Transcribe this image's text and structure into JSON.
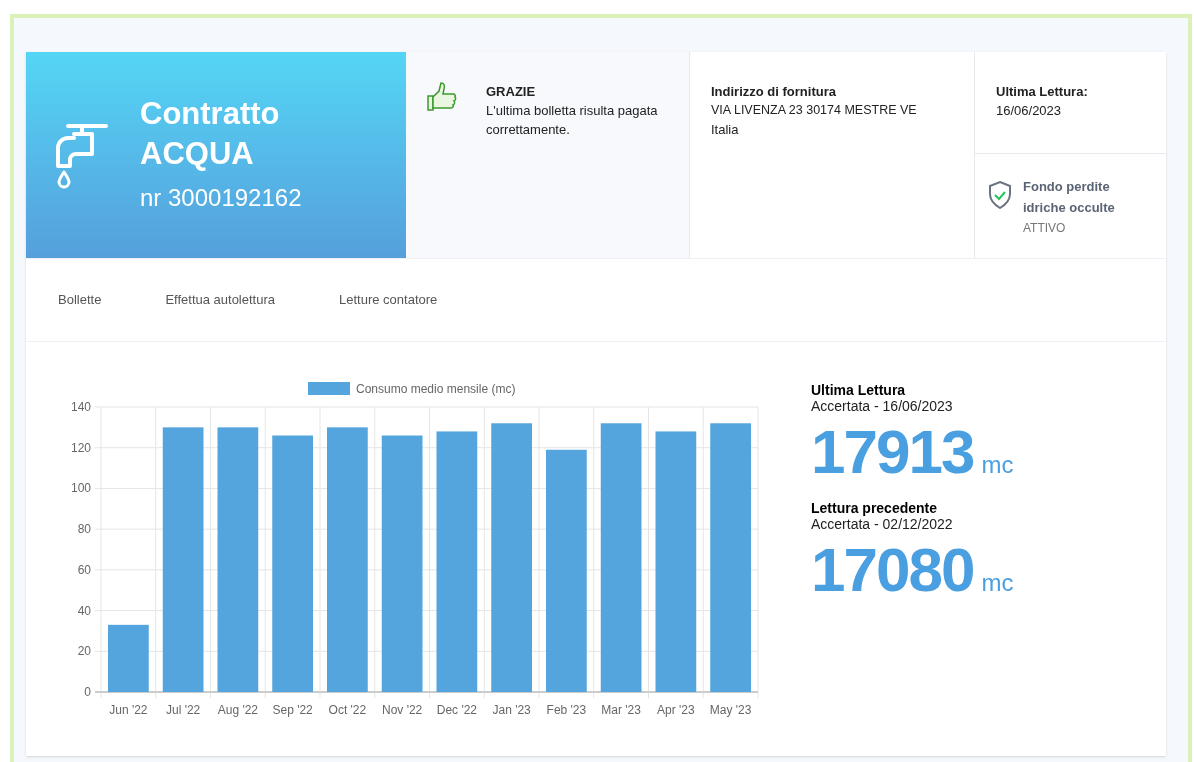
{
  "contract": {
    "title_line1": "Contratto",
    "title_line2": "ACQUA",
    "number": "nr 3000192162"
  },
  "payment": {
    "title": "GRAZIE",
    "message": "L'ultima bolletta risulta pagata correttamente."
  },
  "address": {
    "title": "Indirizzo di fornitura",
    "line1": "VIA LIVENZA 23 30174 MESTRE VE",
    "line2": "Italia"
  },
  "last_reading": {
    "title": "Ultima Lettura:",
    "date": "16/06/2023"
  },
  "leak_fund": {
    "title": "Fondo perdite idriche occulte",
    "status": "ATTIVO",
    "active": true
  },
  "tabs": [
    {
      "label": "Bollette",
      "selected": false
    },
    {
      "label": "Effettua autolettura",
      "selected": false
    },
    {
      "label": "Letture contatore",
      "selected": false
    }
  ],
  "chart_data": {
    "type": "bar",
    "categories": [
      "Jun '22",
      "Jul '22",
      "Aug '22",
      "Sep '22",
      "Oct '22",
      "Nov '22",
      "Dec '22",
      "Jan '23",
      "Feb '23",
      "Mar '23",
      "Apr '23",
      "May '23"
    ],
    "series": [
      {
        "name": "Consumo medio mensile (mc)",
        "color": "#54a5dd",
        "values": [
          33,
          130,
          130,
          126,
          130,
          126,
          128,
          132,
          119,
          132,
          128,
          132
        ]
      }
    ],
    "grid": true,
    "ylim": [
      0,
      140
    ],
    "yticks": [
      0,
      20,
      40,
      60,
      80,
      100,
      120,
      140
    ]
  },
  "readings": [
    {
      "title": "Ultima Lettura",
      "subtitle": "Accertata - 16/06/2023",
      "value": "17913",
      "unit": "mc"
    },
    {
      "title": "Lettura precedente",
      "subtitle": "Accertata - 02/12/2022",
      "value": "17080",
      "unit": "mc"
    }
  ]
}
